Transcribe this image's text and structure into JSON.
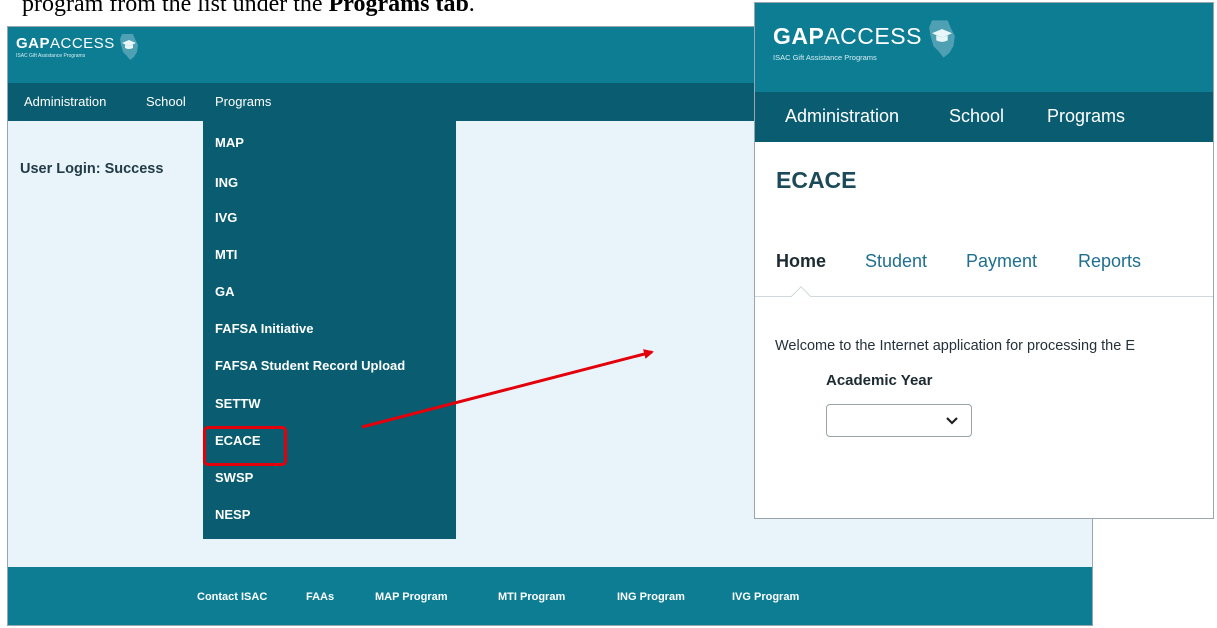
{
  "caption": {
    "text_before": "program from the list under the ",
    "bold_text": "Programs tab",
    "text_after": "."
  },
  "colors": {
    "header_teal": "#0d7d94",
    "nav_dark_teal": "#0a5d70",
    "content_light_blue": "#e8f4fa",
    "highlight_red": "#e3000b"
  },
  "brand": {
    "logo_bold": "GAP",
    "logo_thin": "ACCESS",
    "tagline": "ISAC Gift Assistance Programs",
    "emblem_icon": "state-outline-graduation-cap-icon"
  },
  "left_screen": {
    "nav": [
      "Administration",
      "School",
      "Programs"
    ],
    "login_status": "User Login: Success",
    "programs_menu": [
      "MAP",
      "ING",
      "IVG",
      "MTI",
      "GA",
      "FAFSA Initiative",
      "FAFSA Student Record Upload",
      "SETTW",
      "ECACE",
      "SWSP",
      "NESP"
    ],
    "highlighted_item": "ECACE",
    "footer_links": [
      "Contact ISAC",
      "FAAs",
      "MAP Program",
      "MTI Program",
      "ING Program",
      "IVG Program"
    ]
  },
  "right_screen": {
    "nav": [
      "Administration",
      "School",
      "Programs"
    ],
    "page_title": "ECACE",
    "tabs": [
      "Home",
      "Student",
      "Payment",
      "Reports"
    ],
    "active_tab": "Home",
    "welcome_text": "Welcome to the Internet application for processing the E",
    "academic_year_label": "Academic Year",
    "academic_year_value": "",
    "dropdown_icon": "chevron-down-icon"
  },
  "annotation": {
    "arrow_color": "#e3000b"
  }
}
